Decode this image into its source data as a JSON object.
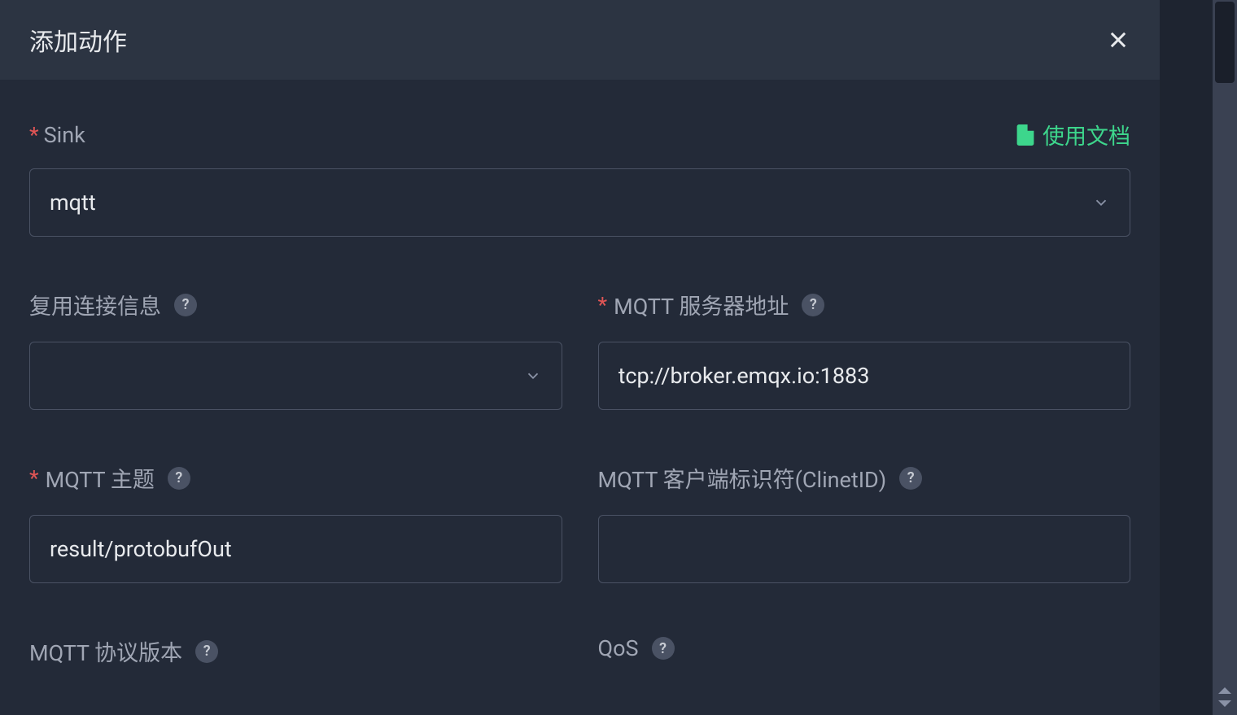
{
  "modal": {
    "title": "添加动作",
    "docs_link_label": "使用文档"
  },
  "fields": {
    "sink": {
      "label": "Sink",
      "value": "mqtt",
      "required": true
    },
    "reuse_connection": {
      "label": "复用连接信息",
      "value": "",
      "required": false
    },
    "mqtt_server": {
      "label": "MQTT 服务器地址",
      "value": "tcp://broker.emqx.io:1883",
      "required": true
    },
    "mqtt_topic": {
      "label": "MQTT 主题",
      "value": "result/protobufOut",
      "required": true
    },
    "mqtt_client_id": {
      "label": "MQTT 客户端标识符(ClinetID)",
      "value": "",
      "required": false
    },
    "mqtt_protocol_version": {
      "label": "MQTT 协议版本",
      "value": "",
      "required": false
    },
    "qos": {
      "label": "QoS",
      "value": "",
      "required": false
    }
  }
}
